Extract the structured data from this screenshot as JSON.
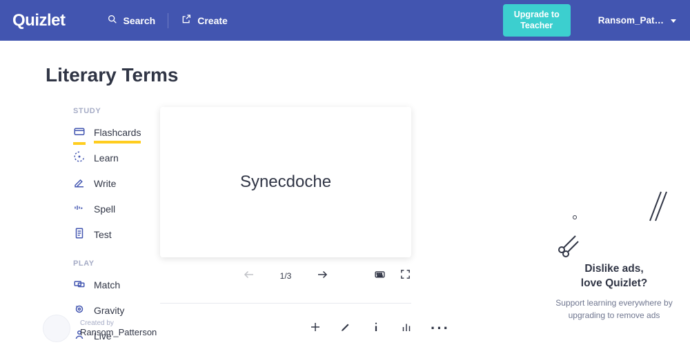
{
  "header": {
    "logo": "Quizlet",
    "search": "Search",
    "create": "Create",
    "upgrade_line1": "Upgrade to",
    "upgrade_line2": "Teacher",
    "user": "Ransom_Pat…"
  },
  "page": {
    "title": "Literary Terms"
  },
  "nav": {
    "study_label": "STUDY",
    "play_label": "PLAY",
    "flashcards": "Flashcards",
    "learn": "Learn",
    "write": "Write",
    "spell": "Spell",
    "test": "Test",
    "match": "Match",
    "gravity": "Gravity",
    "live": "Live"
  },
  "card": {
    "term": "Synecdoche",
    "counter": "1/3"
  },
  "creator": {
    "label": "Created by",
    "name": "Ransom_Patterson"
  },
  "ad": {
    "title_a": "Dislike ads,",
    "title_b": "love Quizlet?",
    "body": "Support learning everywhere by upgrading to remove ads"
  }
}
